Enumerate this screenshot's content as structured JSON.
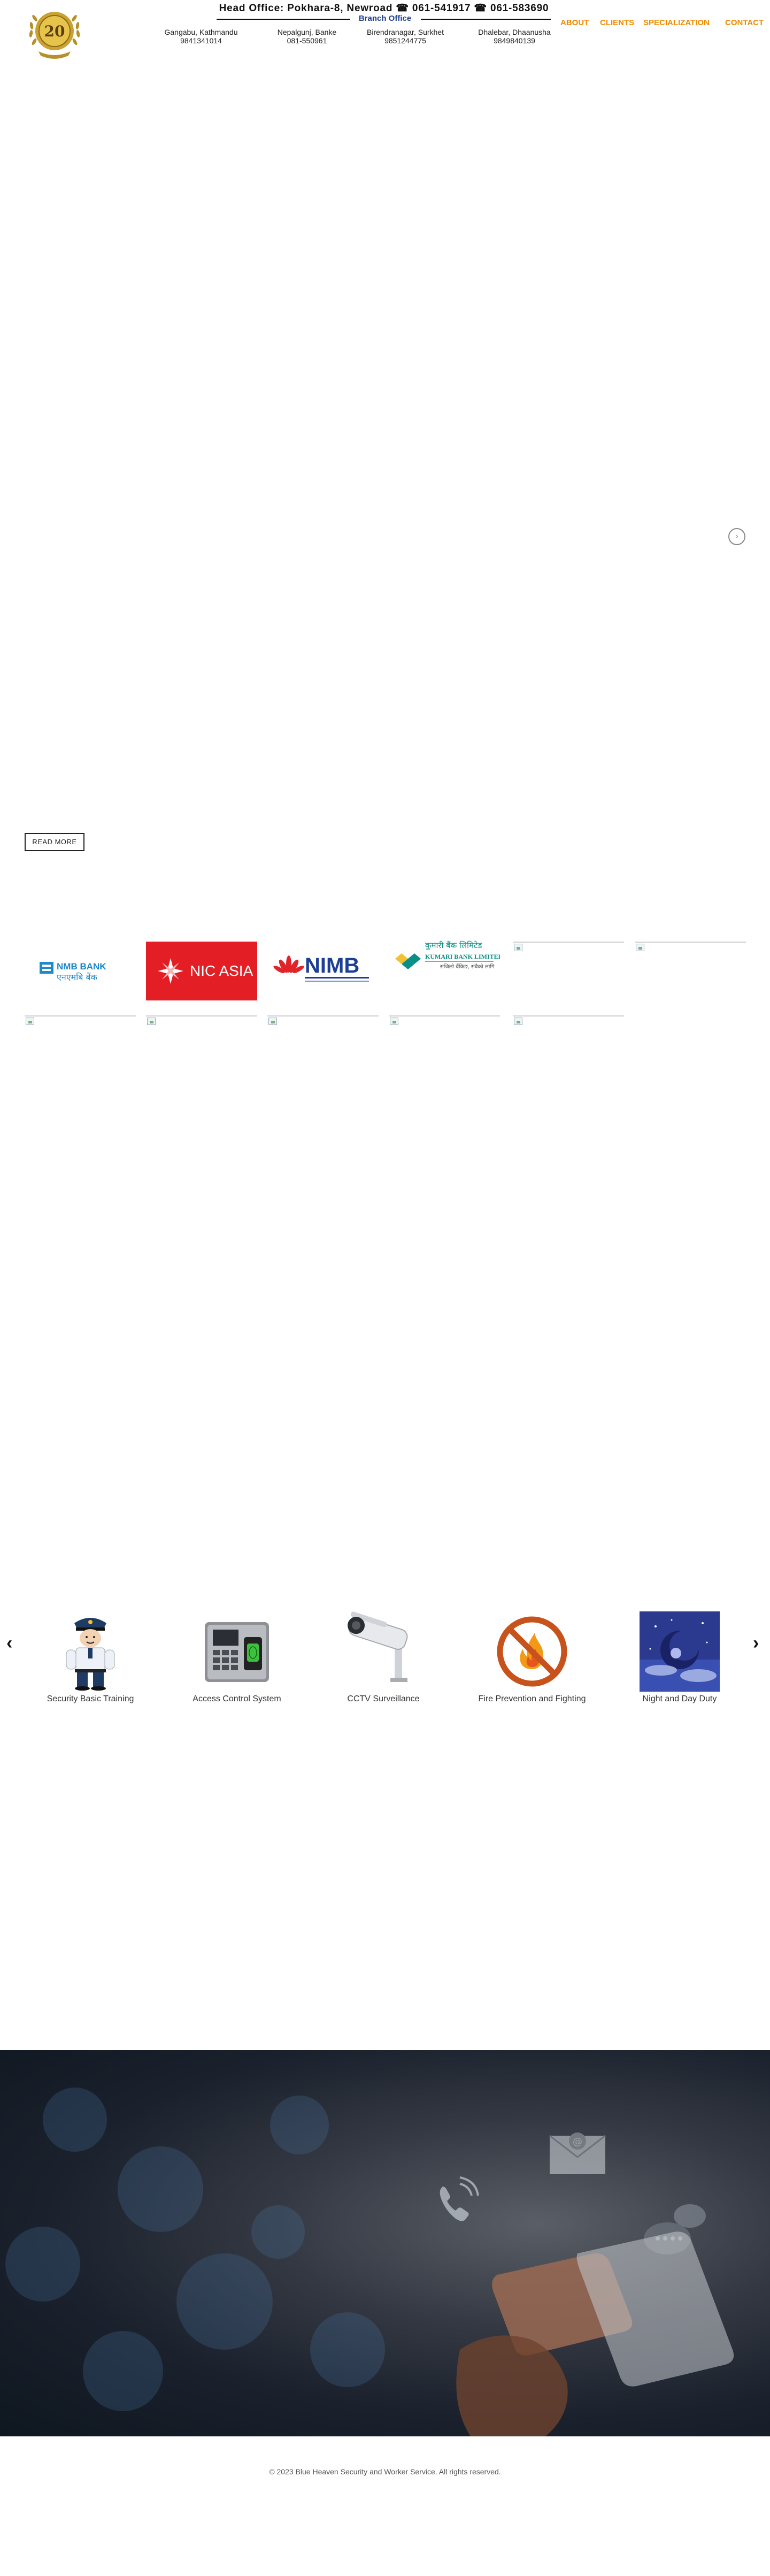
{
  "header": {
    "logo_alt": "20 years emblem",
    "logo_number": "20",
    "head_office": "Head Office: Pokhara-8, Newroad ☎ 061-541917 ☎ 061-583690",
    "branch_title": "Branch Office",
    "branches": [
      {
        "city": "Gangabu, Kathmandu",
        "phone": "9841341014"
      },
      {
        "city": "Nepalgunj, Banke",
        "phone": "081-550961"
      },
      {
        "city": "Birendranagar, Surkhet",
        "phone": "9851244775"
      },
      {
        "city": "Dhalebar, Dhaanusha",
        "phone": "9849840139"
      }
    ],
    "nav": [
      "ABOUT",
      "CLIENTS",
      "SPECIALIZATION",
      "CONTACT"
    ]
  },
  "hero": {
    "next_symbol": "›",
    "read_more": "READ MORE"
  },
  "clients": {
    "nmb": {
      "name": "NMB BANK",
      "sub": "एनएमबि बैंक"
    },
    "nic": {
      "name": "NIC ASIA"
    },
    "nimb": {
      "name": "NIMB"
    },
    "kumari": {
      "name": "KUMARI BANK LIMITED",
      "native": "कुमारी बैंक लिमिटेड",
      "tagline": "सजिलो बैंकिङ, सबैको लागि"
    }
  },
  "services": {
    "prev_symbol": "‹",
    "next_symbol": "›",
    "items": [
      {
        "label": "Security Basic Training"
      },
      {
        "label": "Access Control System"
      },
      {
        "label": "CCTV Surveillance"
      },
      {
        "label": "Fire Prevention and Fighting"
      },
      {
        "label": "Night and Day Duty"
      }
    ]
  },
  "colors": {
    "nav": "#f08a00",
    "branch_title": "#1e3f8a",
    "nmb": "#1e88c8",
    "nic": "#e31e24",
    "nimb": "#1c3f94",
    "kumari": "#0a8f86"
  },
  "footer": {
    "copyright": "© 2023 Blue Heaven Security and Worker Service. All rights reserved."
  }
}
